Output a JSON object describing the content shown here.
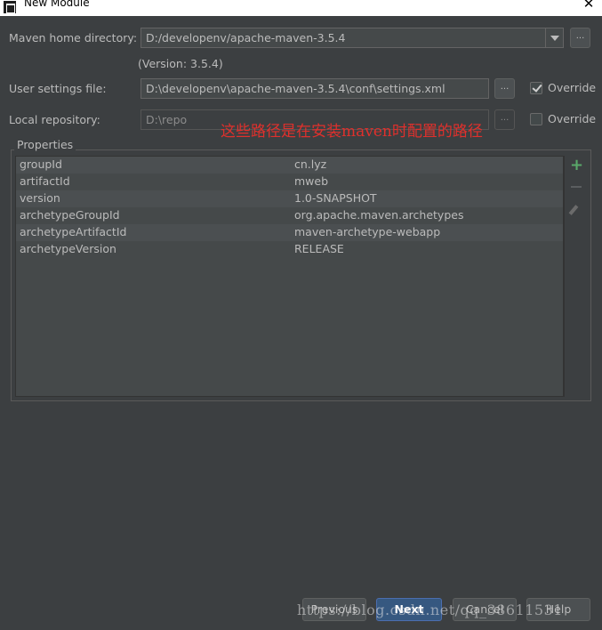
{
  "window": {
    "title": "New Module"
  },
  "form": {
    "maven_home_label": "Maven home directory:",
    "maven_home_value": "D:/developenv/apache-maven-3.5.4",
    "version_text": "(Version: 3.5.4)",
    "user_settings_label": "User settings file:",
    "user_settings_value": "D:\\developenv\\apache-maven-3.5.4\\conf\\settings.xml",
    "local_repo_label": "Local repository:",
    "local_repo_value": "D:\\repo",
    "browse_label": "...",
    "override_label": "Override",
    "override_settings_checked": true,
    "override_repo_checked": false
  },
  "annotation": "这些路径是在安装maven时配置的路径",
  "properties": {
    "title": "Properties",
    "rows": [
      {
        "key": "groupId",
        "value": "cn.lyz"
      },
      {
        "key": "artifactId",
        "value": "mweb"
      },
      {
        "key": "version",
        "value": "1.0-SNAPSHOT"
      },
      {
        "key": "archetypeGroupId",
        "value": "org.apache.maven.archetypes"
      },
      {
        "key": "archetypeArtifactId",
        "value": "maven-archetype-webapp"
      },
      {
        "key": "archetypeVersion",
        "value": "RELEASE"
      }
    ]
  },
  "footer": {
    "previous": "Previous",
    "next": "Next",
    "cancel": "Cancel",
    "help": "Help"
  },
  "watermark": "https://blog.csdn.net/qq_38611531",
  "icons": {
    "add": "plus-icon",
    "remove": "minus-icon",
    "edit": "pencil-icon",
    "close": "close-icon"
  },
  "colors": {
    "background": "#3c3f41",
    "annotation": "#e0302c",
    "add_icon": "#59a869",
    "default_button": "#365880"
  }
}
